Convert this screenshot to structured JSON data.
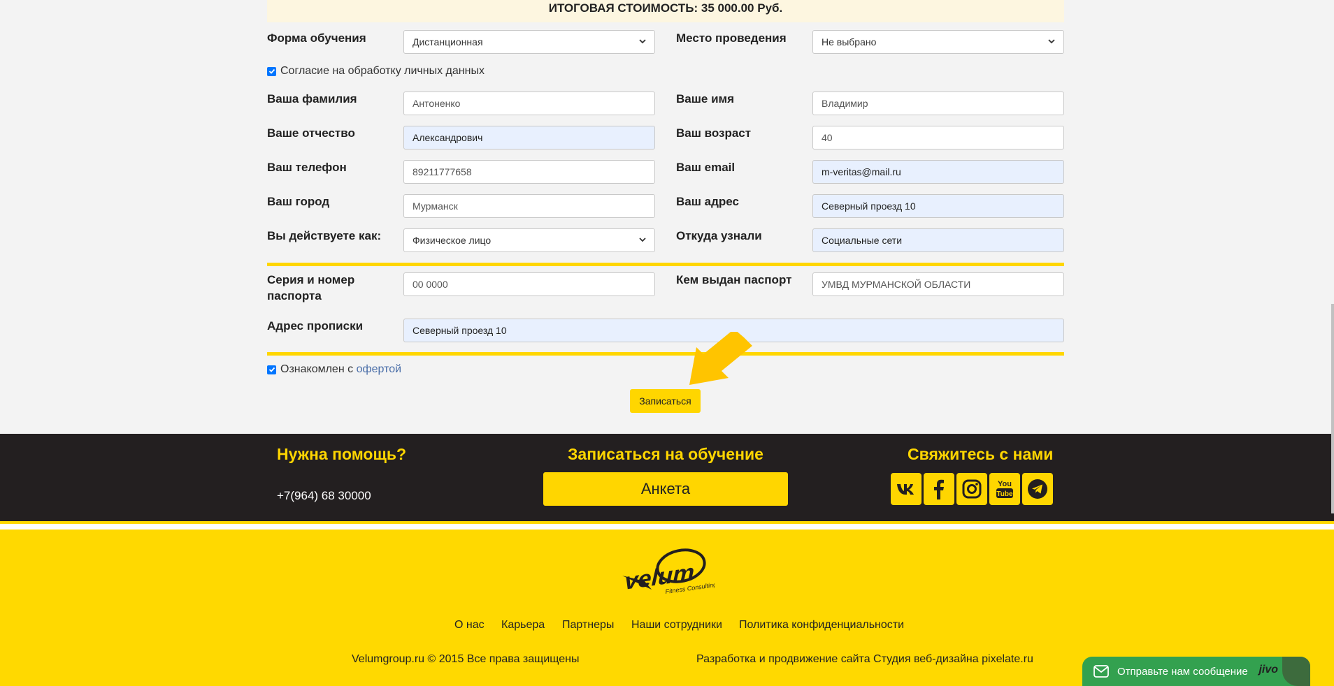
{
  "summary": {
    "total": "ИТОГОВАЯ СТОИМОСТЬ: 35 000.00 Руб."
  },
  "form": {
    "study_form": {
      "label": "Форма обучения",
      "value": "Дистанционная"
    },
    "venue": {
      "label": "Место проведения",
      "value": "Не выбрано"
    },
    "consent": {
      "label": "Согласие на обработку личных данных",
      "checked": true
    },
    "last_name": {
      "label": "Ваша фамилия",
      "placeholder": "Антоненко"
    },
    "first_name": {
      "label": "Ваше имя",
      "placeholder": "Владимир"
    },
    "patronymic": {
      "label": "Ваше отчество",
      "value": "Александрович"
    },
    "age": {
      "label": "Ваш возраст",
      "placeholder": "40"
    },
    "phone": {
      "label": "Ваш телефон",
      "placeholder": "89211777658"
    },
    "email": {
      "label": "Ваш email",
      "value": "m-veritas@mail.ru"
    },
    "city": {
      "label": "Ваш город",
      "placeholder": "Мурманск"
    },
    "address": {
      "label": "Ваш адрес",
      "value": "Северный проезд 10"
    },
    "acting_as": {
      "label": "Вы действуете как:",
      "value": "Физическое лицо"
    },
    "source": {
      "label": "Откуда узнали",
      "value": "Социальные сети"
    },
    "passport_number": {
      "label_line1": "Серия и номер",
      "label_line2": "паспорта",
      "placeholder": "00 0000"
    },
    "passport_issuer": {
      "label": "Кем выдан паспорт",
      "placeholder": "УМВД МУРМАНСКОЙ ОБЛАСТИ"
    },
    "registration_address": {
      "label": "Адрес прописки",
      "value": "Северный проезд 10"
    },
    "offer": {
      "prefix": "Ознакомлен с ",
      "link": "офертой",
      "checked": true
    },
    "submit_label": "Записаться"
  },
  "footer": {
    "help_title": "Нужна помощь?",
    "phone": "+7(964) 68 30000",
    "enroll_title": "Записаться на обучение",
    "anketa_label": "Анкета",
    "contact_title": "Свяжитесь с нами",
    "social_icons": [
      "vk-icon",
      "facebook-icon",
      "instagram-icon",
      "youtube-icon",
      "telegram-icon"
    ],
    "nav": [
      "О нас",
      "Карьера",
      "Партнеры",
      "Наши сотрудники",
      "Политика конфиденциальности"
    ],
    "copyright": "Velumgroup.ru © 2015 Все права защищены",
    "developer": "Разработка и продвижение сайта Студия веб-дизайна pixelate.ru"
  },
  "chat": {
    "label": "Отправьте нам сообщение",
    "brand": "jivo"
  },
  "colors": {
    "accent": "#ffd600",
    "dark": "#231f20",
    "autofill": "#e8f0fe",
    "chat": "#33a14f"
  }
}
